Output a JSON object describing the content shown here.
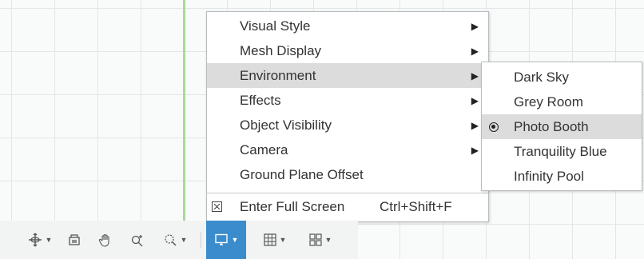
{
  "main_menu": {
    "items": [
      {
        "label": "Visual Style",
        "has_submenu": true
      },
      {
        "label": "Mesh Display",
        "has_submenu": true
      },
      {
        "label": "Environment",
        "has_submenu": true,
        "highlighted": true
      },
      {
        "label": "Effects",
        "has_submenu": true
      },
      {
        "label": "Object Visibility",
        "has_submenu": true
      },
      {
        "label": "Camera",
        "has_submenu": true
      },
      {
        "label": "Ground Plane Offset",
        "has_submenu": false
      }
    ],
    "full_screen": {
      "label": "Enter Full Screen",
      "shortcut": "Ctrl+Shift+F",
      "icon": "fullscreen-icon"
    }
  },
  "environment_submenu": {
    "items": [
      {
        "label": "Dark Sky"
      },
      {
        "label": "Grey Room"
      },
      {
        "label": "Photo Booth",
        "selected": true
      },
      {
        "label": "Tranquility Blue"
      },
      {
        "label": "Infinity Pool"
      }
    ]
  },
  "toolbar": {
    "tools": [
      {
        "icon": "orbit-icon",
        "has_dropdown": true
      },
      {
        "icon": "look-at-icon",
        "has_dropdown": false
      },
      {
        "icon": "pan-hand-icon",
        "has_dropdown": false
      },
      {
        "icon": "zoom-icon",
        "has_dropdown": false
      },
      {
        "icon": "fit-zoom-window-icon",
        "has_dropdown": true
      },
      {
        "icon": "display-settings-icon",
        "has_dropdown": true,
        "active": true
      },
      {
        "icon": "grid-snaps-icon",
        "has_dropdown": true
      },
      {
        "icon": "viewports-icon",
        "has_dropdown": true
      }
    ]
  },
  "colors": {
    "accent": "#3a8ccc",
    "highlight": "#dcdcdc",
    "y_axis": "#a8d89a"
  }
}
